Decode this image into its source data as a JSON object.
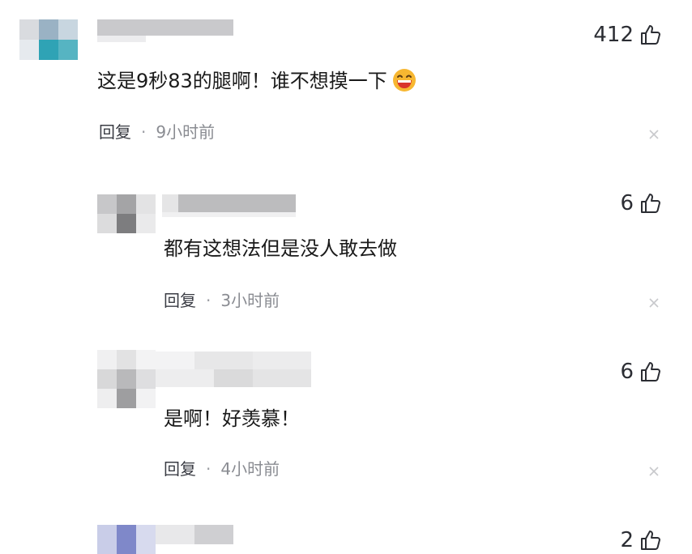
{
  "comments": [
    {
      "text": "这是9秒83的腿啊！谁不想摸一下",
      "emoji": "grinning-face-emoji",
      "reply_label": "回复",
      "separator": "·",
      "time": "9小时前",
      "likes": "412"
    },
    {
      "text": "都有这想法但是没人敢去做",
      "reply_label": "回复",
      "separator": "·",
      "time": "3小时前",
      "likes": "6"
    },
    {
      "text": "是啊！好羡慕！",
      "reply_label": "回复",
      "separator": "·",
      "time": "4小时前",
      "likes": "6"
    },
    {
      "likes": "2"
    }
  ],
  "icons": {
    "like": "thumbs-up-icon",
    "dismiss": "close-icon"
  },
  "colors": {
    "text": "#1a1a1a",
    "meta": "#8a8c92",
    "icon": "#2b2d33",
    "emoji_face": "#f7b731",
    "emoji_mouth": "#d9342b"
  }
}
